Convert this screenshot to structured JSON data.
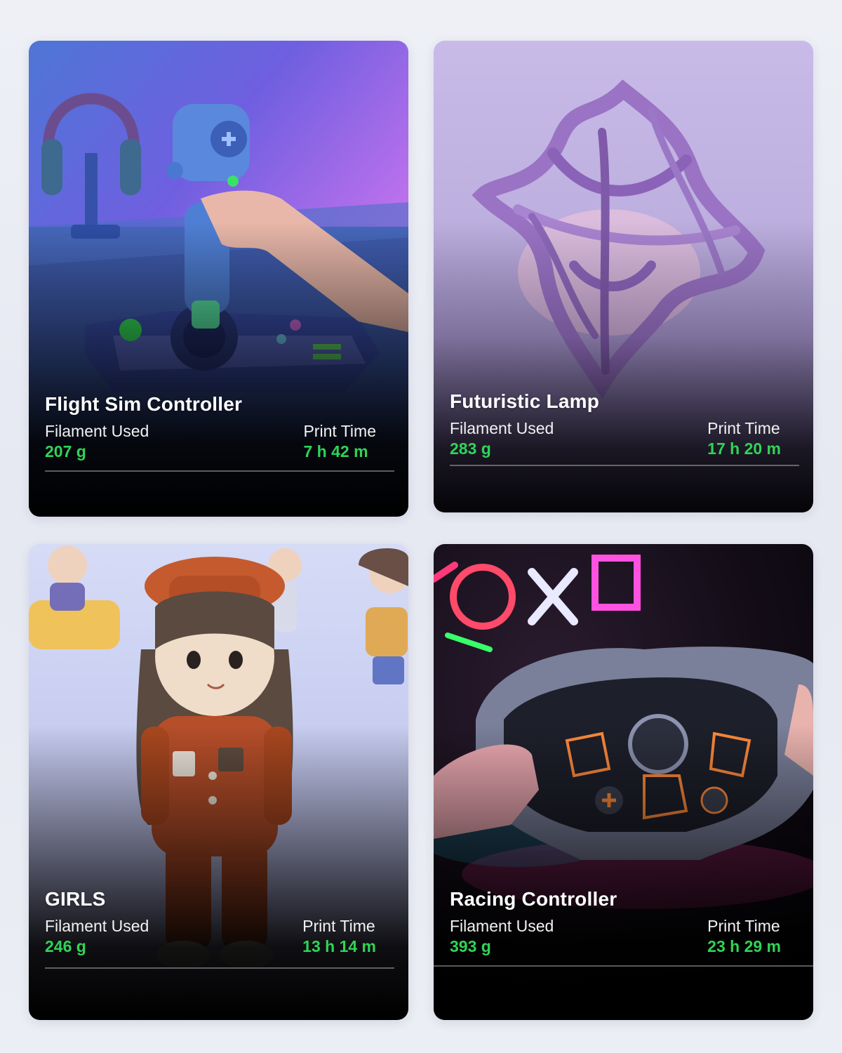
{
  "cards": [
    {
      "title": "Flight Sim Controller",
      "filament_label": "Filament Used",
      "filament_value": "207 g",
      "time_label": "Print Time",
      "time_value": "7 h 42 m"
    },
    {
      "title": "Futuristic Lamp",
      "filament_label": "Filament Used",
      "filament_value": "283 g",
      "time_label": "Print Time",
      "time_value": "17 h 20 m"
    },
    {
      "title": "GIRLS",
      "filament_label": "Filament Used",
      "filament_value": "246 g",
      "time_label": "Print Time",
      "time_value": "13 h 14 m"
    },
    {
      "title": "Racing Controller",
      "filament_label": "Filament Used",
      "filament_value": "393 g",
      "time_label": "Print Time",
      "time_value": "23 h 29 m"
    }
  ],
  "colors": {
    "accent_green": "#2fd457",
    "title_white": "#ffffff"
  }
}
